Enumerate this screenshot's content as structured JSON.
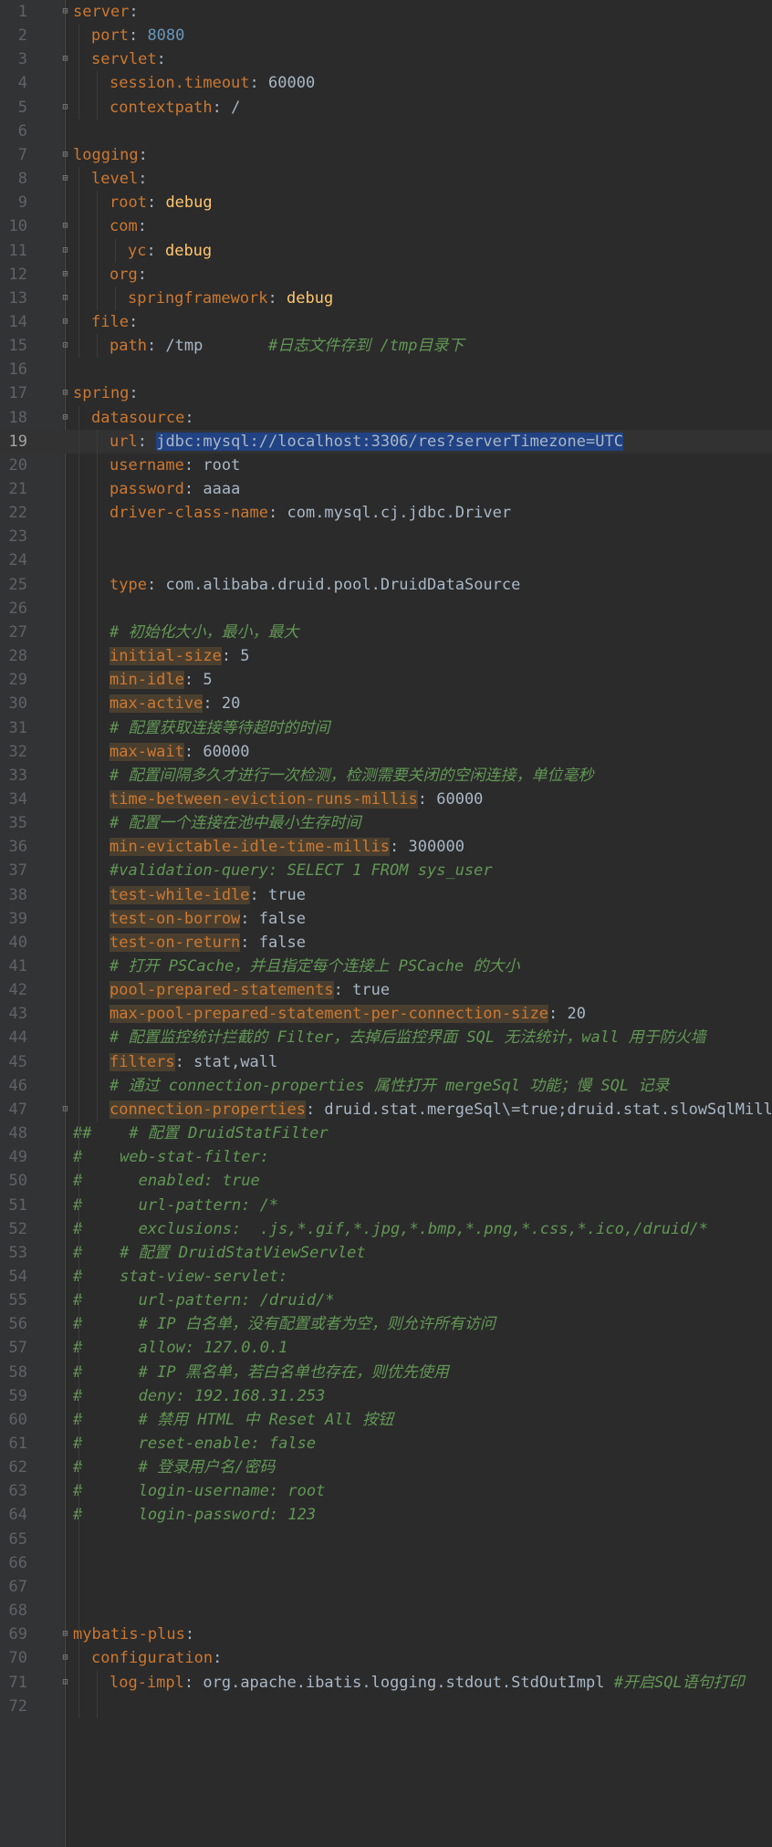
{
  "editor": {
    "language": "yaml",
    "current_line": 19,
    "lines": [
      {
        "num": "1",
        "fold": "open",
        "indent": 0,
        "tokens": [
          {
            "t": "server",
            "c": "k"
          },
          {
            "t": ":",
            "c": "v"
          }
        ]
      },
      {
        "num": "2",
        "fold": "",
        "indent": 1,
        "tokens": [
          {
            "t": "port",
            "c": "k"
          },
          {
            "t": ": ",
            "c": "v"
          },
          {
            "t": "8080",
            "c": "n"
          }
        ]
      },
      {
        "num": "3",
        "fold": "open",
        "indent": 1,
        "tokens": [
          {
            "t": "servlet",
            "c": "k"
          },
          {
            "t": ":",
            "c": "v"
          }
        ]
      },
      {
        "num": "4",
        "fold": "",
        "indent": 2,
        "tokens": [
          {
            "t": "session.timeout",
            "c": "k"
          },
          {
            "t": ": 60000",
            "c": "v"
          }
        ]
      },
      {
        "num": "5",
        "fold": "end",
        "indent": 2,
        "tokens": [
          {
            "t": "contextpath",
            "c": "k"
          },
          {
            "t": ": /",
            "c": "v"
          }
        ]
      },
      {
        "num": "6",
        "fold": "",
        "indent": 0,
        "tokens": []
      },
      {
        "num": "7",
        "fold": "open",
        "indent": 0,
        "tokens": [
          {
            "t": "logging",
            "c": "k"
          },
          {
            "t": ":",
            "c": "v"
          }
        ]
      },
      {
        "num": "8",
        "fold": "open",
        "indent": 1,
        "tokens": [
          {
            "t": "level",
            "c": "k"
          },
          {
            "t": ":",
            "c": "v"
          }
        ]
      },
      {
        "num": "9",
        "fold": "",
        "indent": 2,
        "tokens": [
          {
            "t": "root",
            "c": "k"
          },
          {
            "t": ": ",
            "c": "v"
          },
          {
            "t": "debug",
            "c": "b"
          }
        ]
      },
      {
        "num": "10",
        "fold": "open",
        "indent": 2,
        "tokens": [
          {
            "t": "com",
            "c": "k"
          },
          {
            "t": ":",
            "c": "v"
          }
        ]
      },
      {
        "num": "11",
        "fold": "end",
        "indent": 3,
        "tokens": [
          {
            "t": "yc",
            "c": "k"
          },
          {
            "t": ": ",
            "c": "v"
          },
          {
            "t": "debug",
            "c": "b"
          }
        ]
      },
      {
        "num": "12",
        "fold": "open",
        "indent": 2,
        "tokens": [
          {
            "t": "org",
            "c": "k"
          },
          {
            "t": ":",
            "c": "v"
          }
        ]
      },
      {
        "num": "13",
        "fold": "end",
        "indent": 3,
        "tokens": [
          {
            "t": "springframework",
            "c": "k"
          },
          {
            "t": ": ",
            "c": "v"
          },
          {
            "t": "debug",
            "c": "b"
          }
        ]
      },
      {
        "num": "14",
        "fold": "open",
        "indent": 1,
        "tokens": [
          {
            "t": "file",
            "c": "k"
          },
          {
            "t": ":",
            "c": "v"
          }
        ]
      },
      {
        "num": "15",
        "fold": "end",
        "indent": 2,
        "tokens": [
          {
            "t": "path",
            "c": "k"
          },
          {
            "t": ": /tmp       ",
            "c": "v"
          },
          {
            "t": "#日志文件存到 /tmp目录下",
            "c": "c"
          }
        ]
      },
      {
        "num": "16",
        "fold": "",
        "indent": 0,
        "tokens": []
      },
      {
        "num": "17",
        "fold": "open",
        "indent": 0,
        "tokens": [
          {
            "t": "spring",
            "c": "k"
          },
          {
            "t": ":",
            "c": "v"
          }
        ]
      },
      {
        "num": "18",
        "fold": "open",
        "indent": 1,
        "tokens": [
          {
            "t": "datasource",
            "c": "k"
          },
          {
            "t": ":",
            "c": "v"
          }
        ]
      },
      {
        "num": "19",
        "fold": "",
        "indent": 2,
        "tokens": [
          {
            "t": "url",
            "c": "k"
          },
          {
            "t": ": ",
            "c": "v"
          },
          {
            "t": "jdbc:mysql://localhost:3306/res?serverTimezone=UTC",
            "c": "sel"
          }
        ]
      },
      {
        "num": "20",
        "fold": "",
        "indent": 2,
        "tokens": [
          {
            "t": "username",
            "c": "k"
          },
          {
            "t": ": root",
            "c": "v"
          }
        ]
      },
      {
        "num": "21",
        "fold": "",
        "indent": 2,
        "tokens": [
          {
            "t": "password",
            "c": "k"
          },
          {
            "t": ": aaaa",
            "c": "v"
          }
        ]
      },
      {
        "num": "22",
        "fold": "",
        "indent": 2,
        "tokens": [
          {
            "t": "driver-class-name",
            "c": "k"
          },
          {
            "t": ": ",
            "c": "v"
          },
          {
            "t": "com.mysql.cj.jdbc.Driver",
            "c": "v"
          }
        ]
      },
      {
        "num": "23",
        "fold": "",
        "indent": 2,
        "tokens": []
      },
      {
        "num": "24",
        "fold": "",
        "indent": 2,
        "tokens": []
      },
      {
        "num": "25",
        "fold": "",
        "indent": 2,
        "tokens": [
          {
            "t": "type",
            "c": "k"
          },
          {
            "t": ": ",
            "c": "v"
          },
          {
            "t": "com.alibaba.druid.pool.DruidDataSource",
            "c": "v"
          }
        ]
      },
      {
        "num": "26",
        "fold": "",
        "indent": 2,
        "tokens": []
      },
      {
        "num": "27",
        "fold": "",
        "indent": 2,
        "tokens": [
          {
            "t": "# 初始化大小，最小，最大",
            "c": "c"
          }
        ]
      },
      {
        "num": "28",
        "fold": "",
        "indent": 2,
        "tokens": [
          {
            "t": "initial-size",
            "c": "k hl"
          },
          {
            "t": ": 5",
            "c": "v"
          }
        ]
      },
      {
        "num": "29",
        "fold": "",
        "indent": 2,
        "tokens": [
          {
            "t": "min-idle",
            "c": "k hl"
          },
          {
            "t": ": 5",
            "c": "v"
          }
        ]
      },
      {
        "num": "30",
        "fold": "",
        "indent": 2,
        "tokens": [
          {
            "t": "max-active",
            "c": "k hl"
          },
          {
            "t": ": 20",
            "c": "v"
          }
        ]
      },
      {
        "num": "31",
        "fold": "",
        "indent": 2,
        "tokens": [
          {
            "t": "# 配置获取连接等待超时的时间",
            "c": "c"
          }
        ]
      },
      {
        "num": "32",
        "fold": "",
        "indent": 2,
        "tokens": [
          {
            "t": "max-wait",
            "c": "k hl"
          },
          {
            "t": ": 60000",
            "c": "v"
          }
        ]
      },
      {
        "num": "33",
        "fold": "",
        "indent": 2,
        "tokens": [
          {
            "t": "# 配置间隔多久才进行一次检测，检测需要关闭的空闲连接，单位毫秒",
            "c": "c"
          }
        ]
      },
      {
        "num": "34",
        "fold": "",
        "indent": 2,
        "tokens": [
          {
            "t": "time-between-eviction-runs-millis",
            "c": "k hl"
          },
          {
            "t": ": 60000",
            "c": "v"
          }
        ]
      },
      {
        "num": "35",
        "fold": "",
        "indent": 2,
        "tokens": [
          {
            "t": "# 配置一个连接在池中最小生存时间",
            "c": "c"
          }
        ]
      },
      {
        "num": "36",
        "fold": "",
        "indent": 2,
        "tokens": [
          {
            "t": "min-evictable-idle-time-millis",
            "c": "k hl"
          },
          {
            "t": ": 300000",
            "c": "v"
          }
        ]
      },
      {
        "num": "37",
        "fold": "",
        "indent": 2,
        "tokens": [
          {
            "t": "#validation-query: SELECT 1 FROM sys_user",
            "c": "c"
          }
        ]
      },
      {
        "num": "38",
        "fold": "",
        "indent": 2,
        "tokens": [
          {
            "t": "test-while-idle",
            "c": "k hl"
          },
          {
            "t": ": true",
            "c": "v"
          }
        ]
      },
      {
        "num": "39",
        "fold": "",
        "indent": 2,
        "tokens": [
          {
            "t": "test-on-borrow",
            "c": "k hl"
          },
          {
            "t": ": false",
            "c": "v"
          }
        ]
      },
      {
        "num": "40",
        "fold": "",
        "indent": 2,
        "tokens": [
          {
            "t": "test-on-return",
            "c": "k hl"
          },
          {
            "t": ": false",
            "c": "v"
          }
        ]
      },
      {
        "num": "41",
        "fold": "",
        "indent": 2,
        "tokens": [
          {
            "t": "# 打开 PSCache，并且指定每个连接上 PSCache 的大小",
            "c": "c"
          }
        ]
      },
      {
        "num": "42",
        "fold": "",
        "indent": 2,
        "tokens": [
          {
            "t": "pool-prepared-statements",
            "c": "k hl"
          },
          {
            "t": ": true",
            "c": "v"
          }
        ]
      },
      {
        "num": "43",
        "fold": "",
        "indent": 2,
        "tokens": [
          {
            "t": "max-pool-prepared-statement-per-connection-size",
            "c": "k hl"
          },
          {
            "t": ": 20",
            "c": "v"
          }
        ]
      },
      {
        "num": "44",
        "fold": "",
        "indent": 2,
        "tokens": [
          {
            "t": "# 配置监控统计拦截的 Filter，去掉后监控界面 SQL 无法统计，wall 用于防火墙",
            "c": "c"
          }
        ]
      },
      {
        "num": "45",
        "fold": "",
        "indent": 2,
        "tokens": [
          {
            "t": "filters",
            "c": "k hl"
          },
          {
            "t": ": stat,wall",
            "c": "v"
          }
        ]
      },
      {
        "num": "46",
        "fold": "",
        "indent": 2,
        "tokens": [
          {
            "t": "# 通过 connection-properties 属性打开 mergeSql 功能；慢 SQL 记录",
            "c": "c"
          }
        ]
      },
      {
        "num": "47",
        "fold": "end",
        "indent": 2,
        "tokens": [
          {
            "t": "connection-properties",
            "c": "k hl"
          },
          {
            "t": ": druid.stat.mergeSql\\=true;druid.stat.slowSqlMillis",
            "c": "v"
          }
        ]
      },
      {
        "num": "48",
        "fold": "",
        "indent": 0,
        "tokens": [
          {
            "t": "##    # 配置 DruidStatFilter",
            "c": "c"
          }
        ]
      },
      {
        "num": "49",
        "fold": "",
        "indent": 0,
        "tokens": [
          {
            "t": "#    web-stat-filter:",
            "c": "c"
          }
        ]
      },
      {
        "num": "50",
        "fold": "",
        "indent": 0,
        "tokens": [
          {
            "t": "#      enabled: true",
            "c": "c"
          }
        ]
      },
      {
        "num": "51",
        "fold": "",
        "indent": 0,
        "tokens": [
          {
            "t": "#      url-pattern: /*",
            "c": "c"
          }
        ]
      },
      {
        "num": "52",
        "fold": "",
        "indent": 0,
        "tokens": [
          {
            "t": "#      exclusions:  .js,*.gif,*.jpg,*.bmp,*.png,*.css,*.ico,/druid/*",
            "c": "c"
          }
        ]
      },
      {
        "num": "53",
        "fold": "",
        "indent": 0,
        "tokens": [
          {
            "t": "#    # 配置 DruidStatViewServlet",
            "c": "c"
          }
        ]
      },
      {
        "num": "54",
        "fold": "",
        "indent": 0,
        "tokens": [
          {
            "t": "#    stat-view-servlet:",
            "c": "c"
          }
        ]
      },
      {
        "num": "55",
        "fold": "",
        "indent": 0,
        "tokens": [
          {
            "t": "#      url-pattern: /druid/*",
            "c": "c"
          }
        ]
      },
      {
        "num": "56",
        "fold": "",
        "indent": 0,
        "tokens": [
          {
            "t": "#      # IP 白名单，没有配置或者为空，则允许所有访问",
            "c": "c"
          }
        ]
      },
      {
        "num": "57",
        "fold": "",
        "indent": 0,
        "tokens": [
          {
            "t": "#      allow: 127.0.0.1",
            "c": "c"
          }
        ]
      },
      {
        "num": "58",
        "fold": "",
        "indent": 0,
        "tokens": [
          {
            "t": "#      # IP 黑名单，若白名单也存在，则优先使用",
            "c": "c"
          }
        ]
      },
      {
        "num": "59",
        "fold": "",
        "indent": 0,
        "tokens": [
          {
            "t": "#      deny: 192.168.31.253",
            "c": "c"
          }
        ]
      },
      {
        "num": "60",
        "fold": "",
        "indent": 0,
        "tokens": [
          {
            "t": "#      # 禁用 HTML 中 Reset All 按钮",
            "c": "c"
          }
        ]
      },
      {
        "num": "61",
        "fold": "",
        "indent": 0,
        "tokens": [
          {
            "t": "#      reset-enable: false",
            "c": "c"
          }
        ]
      },
      {
        "num": "62",
        "fold": "",
        "indent": 0,
        "tokens": [
          {
            "t": "#      # 登录用户名/密码",
            "c": "c"
          }
        ]
      },
      {
        "num": "63",
        "fold": "",
        "indent": 0,
        "tokens": [
          {
            "t": "#      login-username: root",
            "c": "c"
          }
        ]
      },
      {
        "num": "64",
        "fold": "",
        "indent": 0,
        "tokens": [
          {
            "t": "#      login-password: 123",
            "c": "c"
          }
        ]
      },
      {
        "num": "65",
        "fold": "",
        "indent": 0,
        "tokens": []
      },
      {
        "num": "66",
        "fold": "",
        "indent": 0,
        "tokens": []
      },
      {
        "num": "67",
        "fold": "",
        "indent": 0,
        "tokens": []
      },
      {
        "num": "68",
        "fold": "",
        "indent": 0,
        "tokens": []
      },
      {
        "num": "69",
        "fold": "open",
        "indent": 0,
        "tokens": [
          {
            "t": "mybatis-plus",
            "c": "k"
          },
          {
            "t": ":",
            "c": "v"
          }
        ]
      },
      {
        "num": "70",
        "fold": "open",
        "indent": 1,
        "tokens": [
          {
            "t": "configuration",
            "c": "k"
          },
          {
            "t": ":",
            "c": "v"
          }
        ]
      },
      {
        "num": "71",
        "fold": "end",
        "indent": 2,
        "tokens": [
          {
            "t": "log-impl",
            "c": "k"
          },
          {
            "t": ": ",
            "c": "v"
          },
          {
            "t": "org.apache.ibatis.logging.stdout.StdOutImpl ",
            "c": "v"
          },
          {
            "t": "#开启SQL语句打印",
            "c": "c"
          }
        ]
      },
      {
        "num": "72",
        "fold": "",
        "indent": 2,
        "tokens": []
      }
    ]
  },
  "colors": {
    "background": "#2b2b2b",
    "gutter": "#313335",
    "key": "#cc7832",
    "value": "#a9b7c6",
    "number": "#6897bb",
    "comment": "#629755",
    "bold_value": "#ffc66d",
    "selection": "#214283"
  }
}
